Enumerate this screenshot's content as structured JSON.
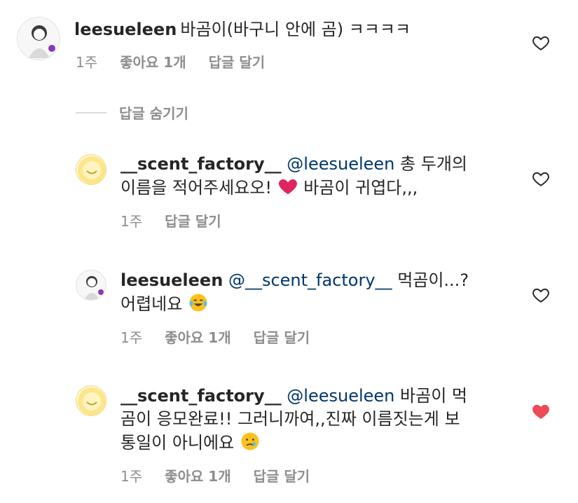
{
  "comments": [
    {
      "username": "leesueleen",
      "text": "바곰이(바구니 안에 곰) ㅋㅋㅋㅋ",
      "time": "1주",
      "likes": "좋아요 1개",
      "reply": "답글 달기",
      "liked": false
    },
    {
      "username": "__scent_factory__",
      "mention": "@leesueleen",
      "text_line1": "총 두개의",
      "text_line2a": "이름을 적어주세요오!",
      "text_line2b": "바곰이 귀엽다,,,",
      "time": "1주",
      "reply": "답글 달기",
      "liked": false
    },
    {
      "username": "leesueleen",
      "mention": "@__scent_factory__",
      "text_line1": "먹곰이...?",
      "text_line2": "어렵네요",
      "time": "1주",
      "likes": "좋아요 1개",
      "reply": "답글 달기",
      "liked": false
    },
    {
      "username": "__scent_factory__",
      "mention": "@leesueleen",
      "text_line1": "바곰이 먹",
      "text_line2": "곰이 응모완료!! 그러니까여,,진짜 이름짓는게 보",
      "text_line3": "통일이 아니에요",
      "time": "1주",
      "likes": "좋아요 1개",
      "reply": "답글 달기",
      "liked": true
    }
  ],
  "hide_replies": "답글 숨기기",
  "colors": {
    "liked_heart": "#ed4956",
    "meta_text": "#8e8e8e",
    "mention": "#00376b"
  },
  "icons": {
    "heart": "heart-outline-icon",
    "heart_filled": "heart-filled-icon",
    "emoji_heart": "red-heart-emoji",
    "emoji_laugh": "tears-of-joy-emoji",
    "emoji_sad": "crying-face-emoji"
  }
}
